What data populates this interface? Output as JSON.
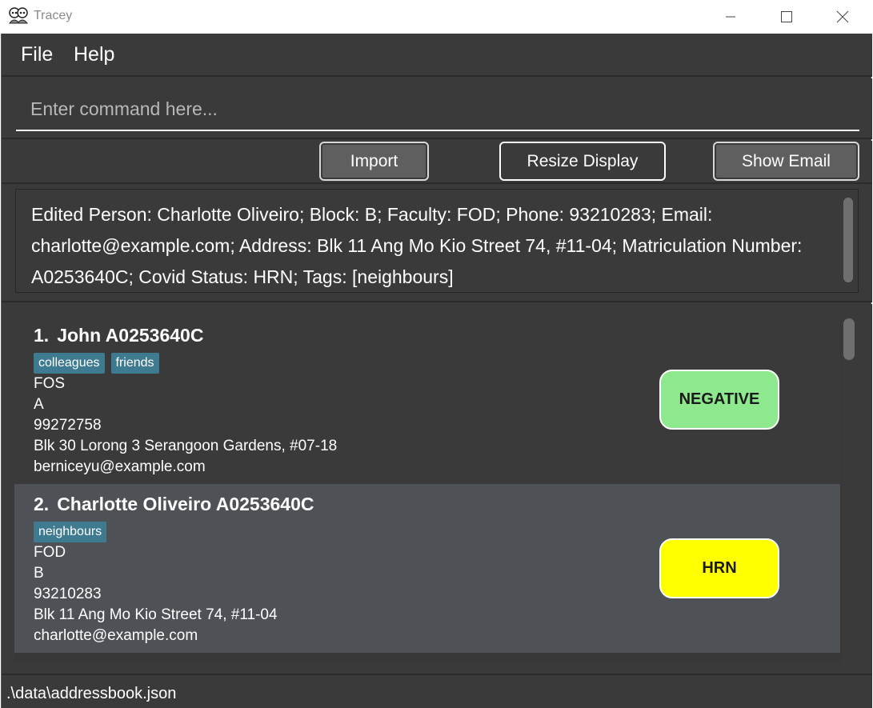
{
  "window": {
    "title": "Tracey",
    "icon": "people-icon"
  },
  "menu": {
    "file": "File",
    "help": "Help"
  },
  "command": {
    "placeholder": "Enter command here...",
    "value": ""
  },
  "buttons": {
    "import": "Import",
    "resize": "Resize Display",
    "show_email": "Show Email"
  },
  "result": {
    "text": "Edited Person: Charlotte Oliveiro; Block: B; Faculty: FOD; Phone: 93210283; Email: charlotte@example.com; Address: Blk 11 Ang Mo Kio Street 74, #11-04; Matriculation Number: A0253640C; Covid Status: HRN; Tags: [neighbours]"
  },
  "persons": [
    {
      "index": "1.",
      "name": "John A0253640C",
      "tags": [
        "colleagues",
        "friends"
      ],
      "faculty": "FOS",
      "block": "A",
      "phone": "99272758",
      "address": "Blk 30 Lorong 3 Serangoon Gardens, #07-18",
      "email": "berniceyu@example.com",
      "status": "NEGATIVE",
      "status_color": "#8ee88e"
    },
    {
      "index": "2.",
      "name": "Charlotte Oliveiro A0253640C",
      "tags": [
        "neighbours"
      ],
      "faculty": "FOD",
      "block": "B",
      "phone": "93210283",
      "address": "Blk 11 Ang Mo Kio Street 74, #11-04",
      "email": "charlotte@example.com",
      "status": "HRN",
      "status_color": "#ffff00"
    }
  ],
  "statusbar": {
    "path": ".\\data\\addressbook.json"
  },
  "colors": {
    "background": "#3a3a3a",
    "selected_card": "#4e5155",
    "tag": "#3e7b91"
  }
}
